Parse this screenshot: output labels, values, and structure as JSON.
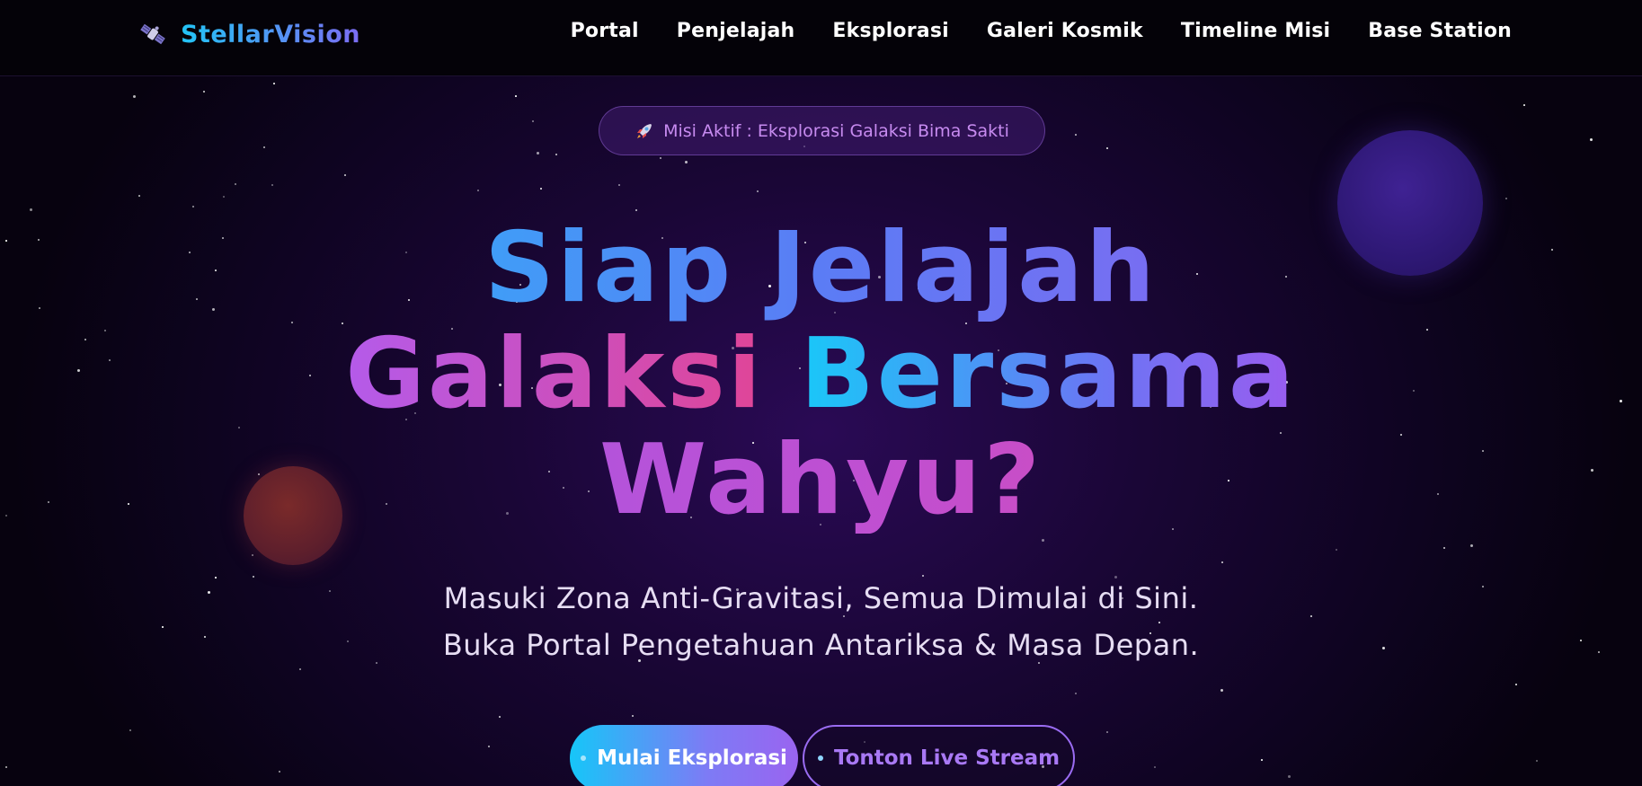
{
  "brand": {
    "name": "StellarVision",
    "icon": "satellite-icon"
  },
  "nav": {
    "items": [
      {
        "label": "Portal"
      },
      {
        "label": "Penjelajah"
      },
      {
        "label": "Eksplorasi"
      },
      {
        "label": "Galeri Kosmik"
      },
      {
        "label": "Timeline Misi"
      },
      {
        "label": "Base Station"
      }
    ]
  },
  "badge": {
    "icon": "rocket-icon",
    "text": "Misi Aktif : Eksplorasi Galaksi Bima Sakti"
  },
  "headline": {
    "line1": "Siap Jelajah",
    "line2a": "Galaksi",
    "line2b": "Bersama",
    "line3": "Wahyu?"
  },
  "subtitle": {
    "line1": "Masuki Zona Anti-Gravitasi, Semua Dimulai di Sini.",
    "line2": "Buka Portal Pengetahuan Antariksa & Masa Depan."
  },
  "buttons": {
    "primary": "Mulai Eksplorasi",
    "secondary": "Tonton Live Stream"
  },
  "colors": {
    "accent_cyan": "#18cdfa",
    "accent_purple": "#9a5cef",
    "accent_pink": "#e8489a",
    "background": "#0b0416"
  }
}
